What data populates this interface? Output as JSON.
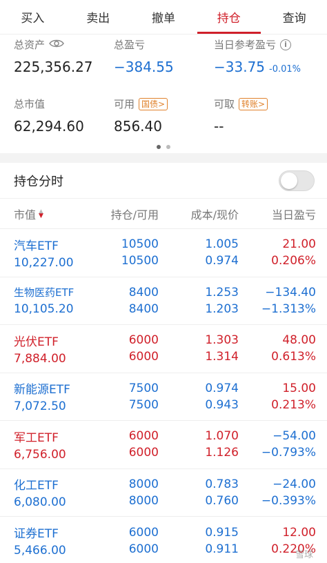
{
  "tabs": [
    "买入",
    "卖出",
    "撤单",
    "持仓",
    "查询"
  ],
  "summary": {
    "total_assets_label": "总资产",
    "total_assets": "225,356.27",
    "total_pl_label": "总盈亏",
    "total_pl": "−384.55",
    "today_pl_label": "当日参考盈亏",
    "today_pl": "−33.75",
    "today_pl_pct": "-0.01%",
    "market_value_label": "总市值",
    "market_value": "62,294.60",
    "available_label": "可用",
    "available_badge": "国债>",
    "available": "856.40",
    "withdrawable_label": "可取",
    "withdrawable_badge": "转账>",
    "withdrawable": "--"
  },
  "toggle": {
    "label": "持仓分时"
  },
  "table": {
    "headers": [
      "市值",
      "持仓/可用",
      "成本/现价",
      "当日盈亏"
    ],
    "rows": [
      {
        "name": "汽车ETF",
        "value": "10,227.00",
        "hold": "10500",
        "avail": "10500",
        "cost": "1.005",
        "price": "0.974",
        "pl": "21.00",
        "pl_pct": "0.206%",
        "color": "blue",
        "pl_color": "red"
      },
      {
        "name": "生物医药ETF",
        "value": "10,105.20",
        "hold": "8400",
        "avail": "8400",
        "cost": "1.253",
        "price": "1.203",
        "pl": "−134.40",
        "pl_pct": "−1.313%",
        "color": "blue",
        "pl_color": "blue"
      },
      {
        "name": "光伏ETF",
        "value": "7,884.00",
        "hold": "6000",
        "avail": "6000",
        "cost": "1.303",
        "price": "1.314",
        "pl": "48.00",
        "pl_pct": "0.613%",
        "color": "red",
        "pl_color": "red"
      },
      {
        "name": "新能源ETF",
        "value": "7,072.50",
        "hold": "7500",
        "avail": "7500",
        "cost": "0.974",
        "price": "0.943",
        "pl": "15.00",
        "pl_pct": "0.213%",
        "color": "blue",
        "pl_color": "red"
      },
      {
        "name": "军工ETF",
        "value": "6,756.00",
        "hold": "6000",
        "avail": "6000",
        "cost": "1.070",
        "price": "1.126",
        "pl": "−54.00",
        "pl_pct": "−0.793%",
        "color": "red",
        "pl_color": "blue"
      },
      {
        "name": "化工ETF",
        "value": "6,080.00",
        "hold": "8000",
        "avail": "8000",
        "cost": "0.783",
        "price": "0.760",
        "pl": "−24.00",
        "pl_pct": "−0.393%",
        "color": "blue",
        "pl_color": "blue"
      },
      {
        "name": "证券ETF",
        "value": "5,466.00",
        "hold": "6000",
        "avail": "6000",
        "cost": "0.915",
        "price": "0.911",
        "pl": "12.00",
        "pl_pct": "0.220%",
        "color": "blue",
        "pl_color": "red"
      }
    ]
  },
  "watermark": "雪球"
}
